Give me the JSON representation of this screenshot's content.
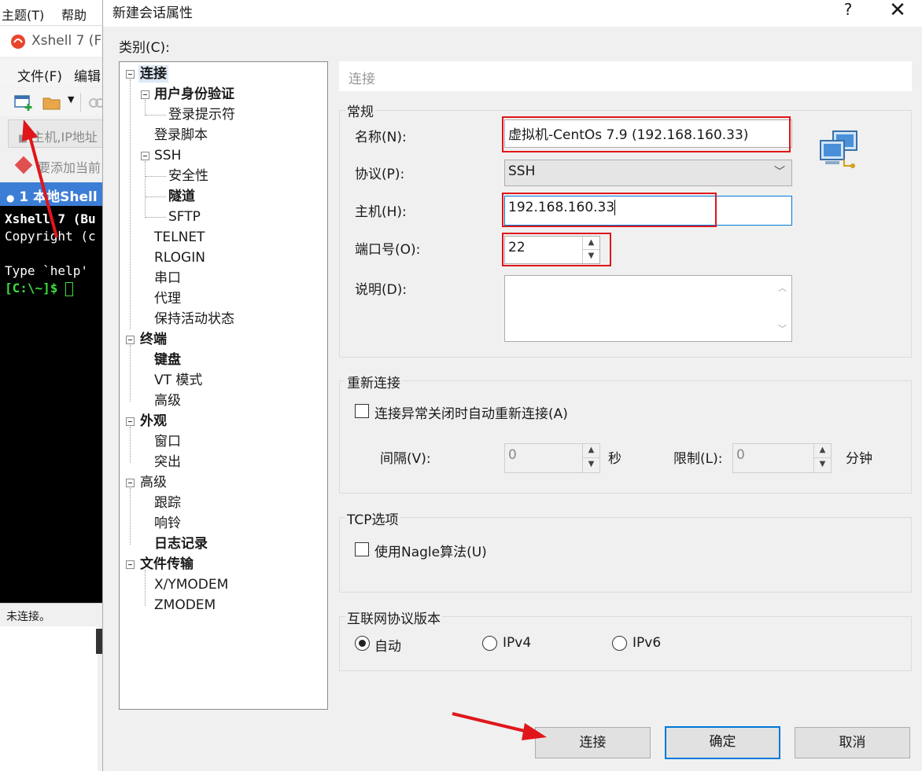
{
  "background_app": {
    "menu_items": [
      "主题(T)",
      "帮助(H)"
    ],
    "window_title": "Xshell 7 (F",
    "menu2": [
      "文件(F)",
      "编辑"
    ],
    "address_placeholder": "主机,IP地址",
    "favorites_hint": "要添加当前",
    "tab_label": "1 本地Shell",
    "terminal_lines": [
      "Xshell 7 (Bu",
      "Copyright (c",
      "",
      "Type `help'"
    ],
    "prompt": "[C:\\~]$ ",
    "status": "未连接。"
  },
  "dialog": {
    "title": "新建会话属性",
    "help_glyph": "?",
    "close_glyph": "✕",
    "category_label": "类别(C):",
    "tree": [
      {
        "label": "连接",
        "bold": true
      },
      {
        "label": "用户身份验证",
        "bold": true
      },
      {
        "label": "登录提示符",
        "bold": false
      },
      {
        "label": "登录脚本",
        "bold": false
      },
      {
        "label": "SSH",
        "bold": false
      },
      {
        "label": "安全性",
        "bold": false
      },
      {
        "label": "隧道",
        "bold": true
      },
      {
        "label": "SFTP",
        "bold": false
      },
      {
        "label": "TELNET",
        "bold": false
      },
      {
        "label": "RLOGIN",
        "bold": false
      },
      {
        "label": "串口",
        "bold": false
      },
      {
        "label": "代理",
        "bold": false
      },
      {
        "label": "保持活动状态",
        "bold": false
      },
      {
        "label": "终端",
        "bold": true
      },
      {
        "label": "键盘",
        "bold": true
      },
      {
        "label": "VT 模式",
        "bold": false
      },
      {
        "label": "高级",
        "bold": false
      },
      {
        "label": "外观",
        "bold": true
      },
      {
        "label": "窗口",
        "bold": false
      },
      {
        "label": "突出",
        "bold": false
      },
      {
        "label": "高级",
        "bold": false
      },
      {
        "label": "跟踪",
        "bold": false
      },
      {
        "label": "响铃",
        "bold": false
      },
      {
        "label": "日志记录",
        "bold": true
      },
      {
        "label": "文件传输",
        "bold": true
      },
      {
        "label": "X/YMODEM",
        "bold": false
      },
      {
        "label": "ZMODEM",
        "bold": false
      }
    ],
    "section_header": "连接",
    "general": {
      "title": "常规",
      "name_label": "名称(N):",
      "name_value": "虚拟机-CentOs 7.9 (192.168.160.33)",
      "protocol_label": "协议(P):",
      "protocol_value": "SSH",
      "host_label": "主机(H):",
      "host_value": "192.168.160.33",
      "port_label": "端口号(O):",
      "port_value": "22",
      "desc_label": "说明(D):",
      "desc_value": ""
    },
    "reconnect": {
      "title": "重新连接",
      "auto_label": "连接异常关闭时自动重新连接(A)",
      "interval_label": "间隔(V):",
      "interval_value": "0",
      "interval_unit": "秒",
      "limit_label": "限制(L):",
      "limit_value": "0",
      "limit_unit": "分钟"
    },
    "tcp": {
      "title": "TCP选项",
      "nagle_label": "使用Nagle算法(U)"
    },
    "ipver": {
      "title": "互联网协议版本",
      "auto": "自动",
      "ipv4": "IPv4",
      "ipv6": "IPv6",
      "selected": "auto"
    },
    "buttons": {
      "connect": "连接",
      "ok": "确定",
      "cancel": "取消"
    }
  },
  "colors": {
    "annotation_red": "#e0161b",
    "focus_blue": "#0078d7",
    "tab_blue": "#3c7dd6"
  }
}
